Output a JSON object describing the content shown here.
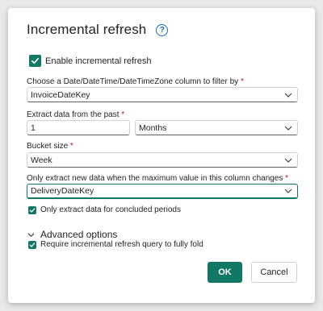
{
  "dialog": {
    "title": "Incremental refresh",
    "help_icon": "question-circle-icon",
    "enable_refresh": {
      "label": "Enable incremental refresh",
      "checked": true
    },
    "date_column": {
      "label": "Choose a Date/DateTime/DateTimeZone column to filter by",
      "required_mark": "*",
      "value": "InvoiceDateKey"
    },
    "extract_past": {
      "label": "Extract data from the past",
      "required_mark": "*",
      "amount": "1",
      "unit": "Months"
    },
    "bucket_size": {
      "label": "Bucket size",
      "required_mark": "*",
      "value": "Week"
    },
    "change_column": {
      "label": "Only extract new data when the maximum value in this column changes",
      "required_mark": "*",
      "value": "DeliveryDateKey"
    },
    "concluded_periods": {
      "label": "Only extract data for concluded periods",
      "checked": true
    },
    "advanced_options": {
      "label": "Advanced options",
      "expanded": true
    },
    "require_fold": {
      "label": "Require incremental refresh query to fully fold",
      "checked": true
    },
    "ok_label": "OK",
    "cancel_label": "Cancel"
  },
  "colors": {
    "accent": "#117865",
    "required": "#c50f1f",
    "help": "#0f6cbd"
  }
}
